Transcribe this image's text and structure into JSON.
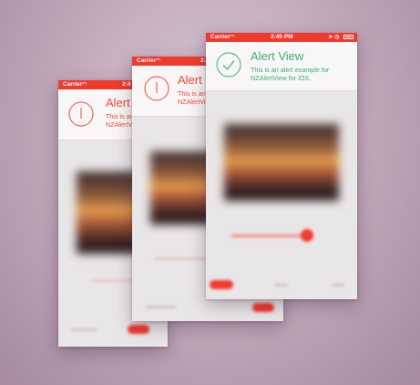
{
  "status_bar": {
    "carrier": "Carrier",
    "time": "2:45 PM",
    "time_partial": "2:4"
  },
  "alerts": {
    "back": {
      "title": "Alert V",
      "message_line1": "This is an",
      "message_line2": "NZAlertVie"
    },
    "middle": {
      "title": "Alert Vi",
      "message_line1": "This is an ale",
      "message_line2": "NZAlertView f"
    },
    "front": {
      "title": "Alert View",
      "message_line1": "This is an alert example for",
      "message_line2": "NZAlertView for iOS."
    }
  },
  "colors": {
    "status_bar": "#f03a2c",
    "error_accent": "#f04a3c",
    "success_accent": "#3bb06b"
  },
  "icons": {
    "back": "exclamation-circle-icon",
    "middle": "exclamation-circle-icon",
    "front": "check-circle-icon"
  }
}
